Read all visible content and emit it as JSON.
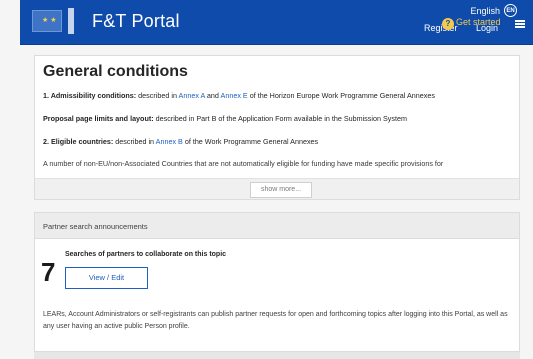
{
  "header": {
    "title": "F&T Portal",
    "language": "English",
    "language_code": "EN",
    "register": "Register",
    "get_started": "Get started",
    "login": "Login",
    "help_icon": "?"
  },
  "conditions": {
    "heading": "General conditions",
    "admissibility": {
      "label": "1. Admissibility conditions:",
      "pre": " described in ",
      "annex_a": "Annex A",
      "and": " and ",
      "annex_e": "Annex E",
      "post": " of the Horizon Europe Work Programme General Annexes"
    },
    "page_limits": {
      "label": "Proposal page limits and layout:",
      "text": " described in Part B of the Application Form available in the Submission System"
    },
    "eligible": {
      "label": "2. Eligible countries:",
      "pre": " described in ",
      "annex_b": "Annex B",
      "post": " of the Work Programme General Annexes"
    },
    "non_eu": "A number of non-EU/non-Associated Countries that are not automatically eligible for funding have made specific provisions for",
    "show_more": "show more..."
  },
  "partner_search": {
    "heading": "Partner search announcements",
    "count": "7",
    "searches_label": "Searches of partners to collaborate on this topic",
    "view_edit": "View / Edit",
    "description": "LEARs, Account Administrators or self-registrants can publish partner requests for open and forthcoming topics after logging into this Portal, as well as any user having an active public Person profile."
  },
  "colors": {
    "header_bg": "#0f4bab",
    "link": "#1f5fbf",
    "accent_yellow": "#f2c94c"
  }
}
